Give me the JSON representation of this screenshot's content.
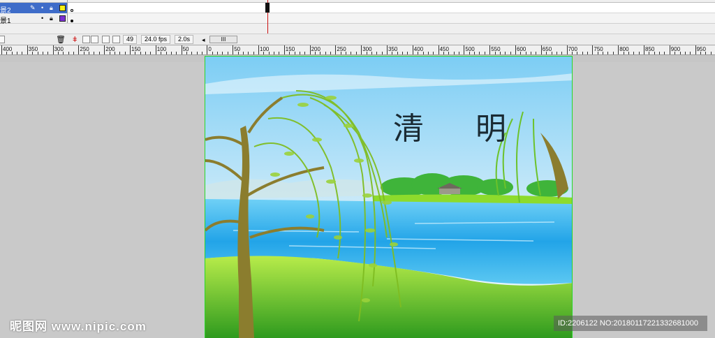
{
  "layers": [
    {
      "name": "景2",
      "selected": true,
      "color": "#f7f012"
    },
    {
      "name": "景1",
      "selected": false,
      "color": "#7a2fd3"
    }
  ],
  "status": {
    "current_frame": "49",
    "frame_rate": "24.0 fps",
    "elapsed_time": "2.0s",
    "scroll_glyph": "III"
  },
  "ruler": {
    "labels": [
      "400",
      "350",
      "300",
      "250",
      "200",
      "150",
      "100",
      "50",
      "0",
      "50",
      "100",
      "150",
      "200",
      "250",
      "300",
      "350",
      "400",
      "450",
      "500",
      "550",
      "600",
      "650",
      "700",
      "750",
      "800",
      "850",
      "900",
      "950"
    ]
  },
  "canvas": {
    "title": "清 明"
  },
  "watermark": {
    "site": "昵图网 www.nipic.com",
    "id_text": "ID:2206122 NO:20180117221332681000"
  },
  "colors": {
    "layer_selected_bg": "#3e6cc9",
    "stage_border": "#28d728",
    "playhead": "#cc1111"
  }
}
